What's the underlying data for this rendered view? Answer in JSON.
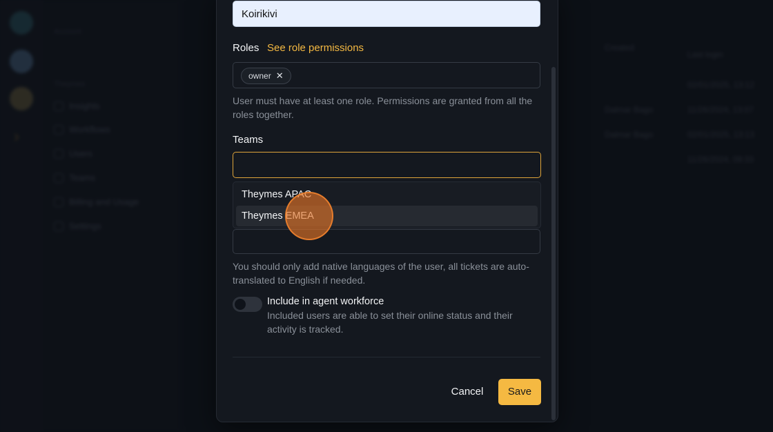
{
  "background": {
    "sidebar_heading_1": "Account",
    "sidebar_heading_2": "Theymes",
    "sidebar_items": [
      "Insights",
      "Workflows",
      "Users",
      "Teams",
      "Billing and Usage",
      "Settings"
    ],
    "table_col_1": "Created",
    "table_col_2": "Last login",
    "table_rows": [
      {
        "user": "",
        "last": "02/01/2025, 13:12"
      },
      {
        "user": "Dalmar Bago",
        "last": "11/26/2024, 13:07"
      },
      {
        "user": "Dalmar Bago",
        "last": "02/01/2025, 13:13"
      },
      {
        "user": "",
        "last": "11/26/2024, 09:33"
      }
    ]
  },
  "form": {
    "name_value": "Koirikivi",
    "roles_label": "Roles",
    "roles_link": "See role permissions",
    "roles_chips": [
      "owner"
    ],
    "chip_remove": "✕",
    "roles_help": "User must have at least one role. Permissions are granted from all the roles together.",
    "teams_label": "Teams",
    "teams_value": "",
    "teams_options": [
      "Theymes APAC",
      "Theymes EMEA"
    ],
    "languages_value": "",
    "languages_help": "You should only add native languages of the user, all tickets are auto-translated to English if needed.",
    "workforce_toggle_on": false,
    "workforce_title": "Include in agent workforce",
    "workforce_help": "Included users are able to set their online status and their activity is tracked.",
    "cancel_label": "Cancel",
    "save_label": "Save"
  },
  "colors": {
    "accent": "#f5b942",
    "background": "#0f131a",
    "modal": "#14181f",
    "focus_border": "#e0a53a",
    "click_indicator": "#e87626"
  }
}
